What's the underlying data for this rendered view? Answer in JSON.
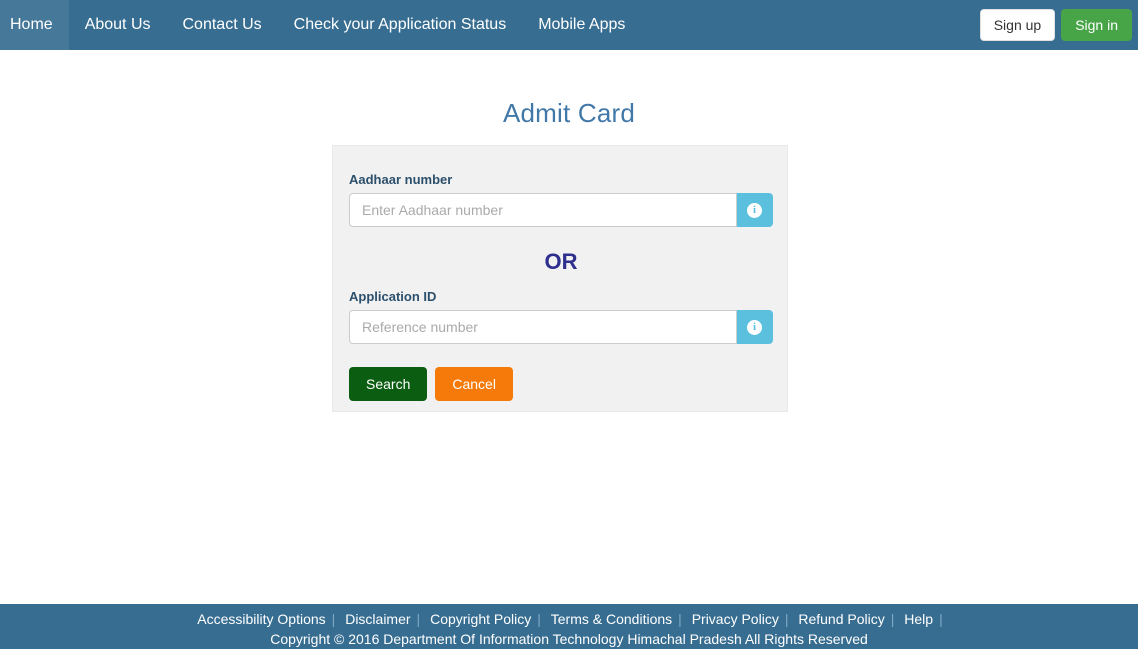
{
  "navbar": {
    "links": [
      {
        "label": "Home",
        "name": "nav-link-home"
      },
      {
        "label": "About Us",
        "name": "nav-link-about-us"
      },
      {
        "label": "Contact Us",
        "name": "nav-link-contact-us"
      },
      {
        "label": "Check your Application Status",
        "name": "nav-link-check-application-status"
      },
      {
        "label": "Mobile Apps",
        "name": "nav-link-mobile-apps"
      }
    ],
    "sign_up_label": "Sign up",
    "sign_in_label": "Sign in",
    "background_color": "#376d91",
    "sign_in_color": "#47a447"
  },
  "main": {
    "page_title": "Admit Card",
    "page_title_color": "#4178a8",
    "aadhaar": {
      "label": "Aadhaar number",
      "placeholder": "Enter Aadhaar number",
      "value": "",
      "info_icon": "info-circle-icon"
    },
    "divider_text": "OR",
    "divider_color": "#2e2e8f",
    "application_id": {
      "label": "Application ID",
      "placeholder": "Reference number",
      "value": "",
      "info_icon": "info-circle-icon"
    },
    "search_label": "Search",
    "search_color": "#0b5d12",
    "cancel_label": "Cancel",
    "cancel_color": "#f57a09",
    "panel_background": "#f1f1f1"
  },
  "footer": {
    "links": [
      {
        "label": "Accessibility Options",
        "name": "footer-link-accessibility-options"
      },
      {
        "label": "Disclaimer",
        "name": "footer-link-disclaimer"
      },
      {
        "label": "Copyright Policy",
        "name": "footer-link-copyright-policy"
      },
      {
        "label": "Terms & Conditions",
        "name": "footer-link-terms-conditions"
      },
      {
        "label": "Privacy Policy",
        "name": "footer-link-privacy-policy"
      },
      {
        "label": "Refund Policy",
        "name": "footer-link-refund-policy"
      },
      {
        "label": "Help",
        "name": "footer-link-help"
      }
    ],
    "separator": "|",
    "copyright": "Copyright © 2016 Department Of Information Technology Himachal Pradesh All Rights Reserved",
    "background_color": "#376d91"
  }
}
